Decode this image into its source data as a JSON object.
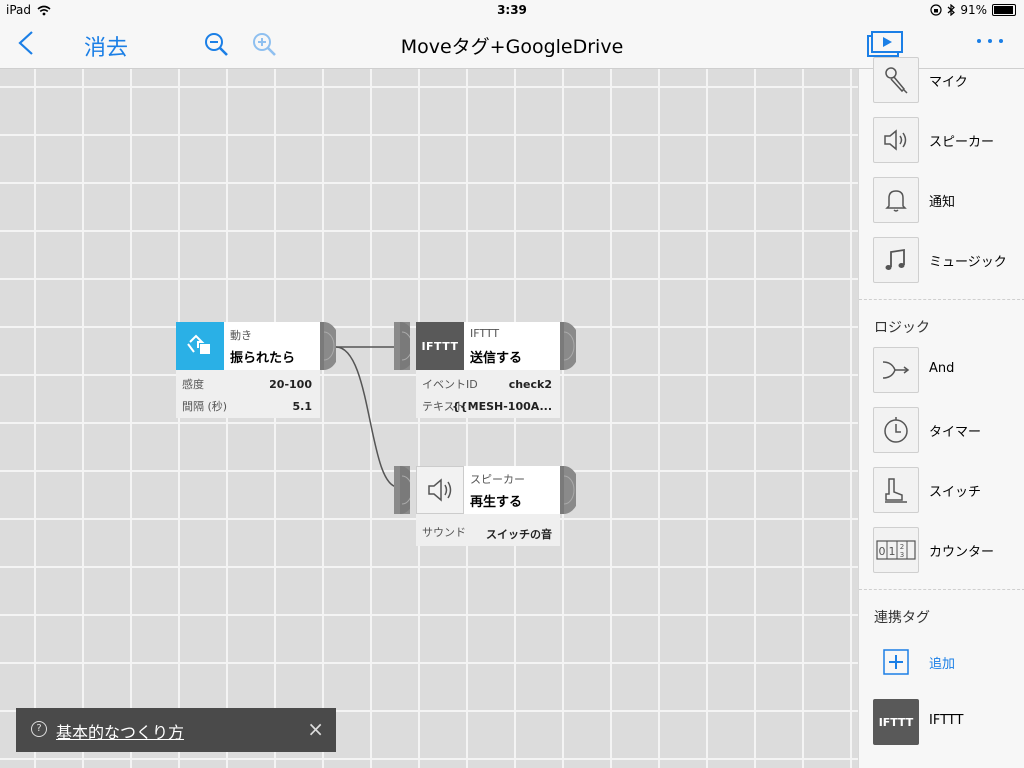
{
  "status": {
    "device": "iPad",
    "time": "3:39",
    "battery": "91%"
  },
  "nav": {
    "delete_label": "消去",
    "title": "Moveタグ+GoogleDrive"
  },
  "blocks": {
    "motion": {
      "category": "動き",
      "name": "振られたら",
      "props": [
        {
          "key": "感度",
          "value": "20-100"
        },
        {
          "key": "間隔 (秒)",
          "value": "5.1"
        }
      ]
    },
    "ifttt": {
      "category": "IFTTT",
      "name": "送信する",
      "logo": "IFTTT",
      "props": [
        {
          "key": "イベントID",
          "value": "check2"
        },
        {
          "key": "テキスト",
          "value": "{{MESH-100A..."
        }
      ]
    },
    "speaker": {
      "category": "スピーカー",
      "name": "再生する",
      "props": [
        {
          "key": "サウンド",
          "value": "スイッチの音"
        }
      ]
    }
  },
  "sidebar": {
    "items_top": [
      {
        "label": "マイク",
        "icon": "microphone-icon"
      },
      {
        "label": "スピーカー",
        "icon": "speaker-icon"
      },
      {
        "label": "通知",
        "icon": "bell-icon"
      },
      {
        "label": "ミュージック",
        "icon": "music-note-icon"
      }
    ],
    "logic_header": "ロジック",
    "logic_items": [
      {
        "label": "And",
        "icon": "and-merge-icon"
      },
      {
        "label": "タイマー",
        "icon": "timer-icon"
      },
      {
        "label": "スイッチ",
        "icon": "switch-icon"
      },
      {
        "label": "カウンター",
        "icon": "counter-icon",
        "digits": "0 1 2 3"
      }
    ],
    "linked_header": "連携タグ",
    "add_label": "追加",
    "ifttt_label": "IFTTT",
    "ifttt_logo": "IFTTT"
  },
  "help": {
    "label": "基本的なつくり方",
    "close": "×",
    "q": "?"
  },
  "colors": {
    "accent": "#1b7fe6",
    "motion": "#2ab0e6",
    "ifttt": "#595959",
    "help_bg": "#4a4a4a"
  }
}
